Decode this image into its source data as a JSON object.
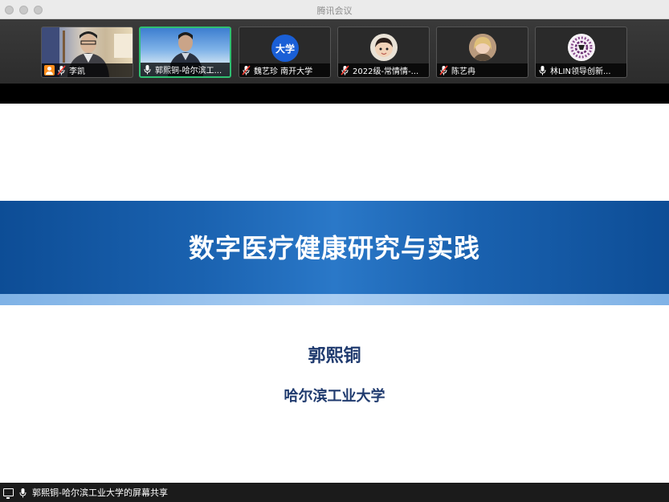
{
  "window": {
    "title": "腾讯会议"
  },
  "participants": [
    {
      "name": "李凯",
      "type": "video",
      "mic": "muted",
      "host": true
    },
    {
      "name": "郭熙铜-哈尔滨工...",
      "type": "video",
      "mic": "on",
      "active": true
    },
    {
      "name": "魏艺珍 南开大学",
      "type": "avatar",
      "avatar_text": "大学",
      "mic": "muted"
    },
    {
      "name": "2022级-常情情-...",
      "type": "avatar",
      "mic": "muted"
    },
    {
      "name": "陈艺冉",
      "type": "avatar",
      "mic": "muted"
    },
    {
      "name": "林LIN领导创新...",
      "type": "avatar",
      "mic": "on"
    }
  ],
  "slide": {
    "title": "数字医疗健康研究与实践",
    "author": "郭熙铜",
    "affiliation": "哈尔滨工业大学"
  },
  "share_bar": {
    "label": "郭熙铜-哈尔滨工业大学的屏幕共享"
  },
  "colors": {
    "banner": "#1a62b0",
    "active_border": "#2fbf71",
    "host_badge": "#ff8c1a",
    "avatar_blue": "#1a5fd6"
  }
}
